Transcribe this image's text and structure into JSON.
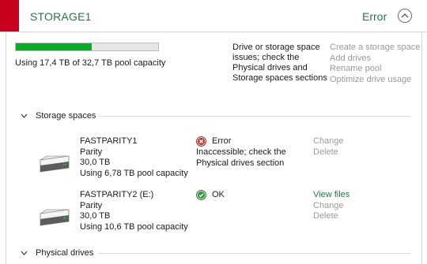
{
  "pool": {
    "name": "STORAGE1",
    "status": "Error",
    "accent_color": "#1e7a45",
    "error_color": "#c8001e",
    "usage_fraction": 0.532,
    "capacity_text": "Using 17,4 TB of 32,7 TB pool capacity",
    "issue_text": "Drive or storage space issues; check the Physical drives and Storage spaces sections",
    "actions": [
      "Create a storage space",
      "Add drives",
      "Rename pool",
      "Optimize drive usage"
    ]
  },
  "sections": {
    "storage_spaces": "Storage spaces",
    "physical_drives": "Physical drives"
  },
  "spaces": [
    {
      "name": "FASTPARITY1",
      "resiliency": "Parity",
      "size": "30,0 TB",
      "usage": "Using 6,78 TB pool capacity",
      "status_icon": "error-icon",
      "status": "Error",
      "status_desc": "Inaccessible; check the Physical drives section",
      "links": [
        "Change",
        "Delete"
      ]
    },
    {
      "name": "FASTPARITY2 (E:)",
      "resiliency": "Parity",
      "size": "30,0 TB",
      "usage": "Using 10,6 TB pool capacity",
      "status_icon": "ok-icon",
      "status": "OK",
      "status_desc": "",
      "links": [
        "View files",
        "Change",
        "Delete"
      ]
    }
  ]
}
